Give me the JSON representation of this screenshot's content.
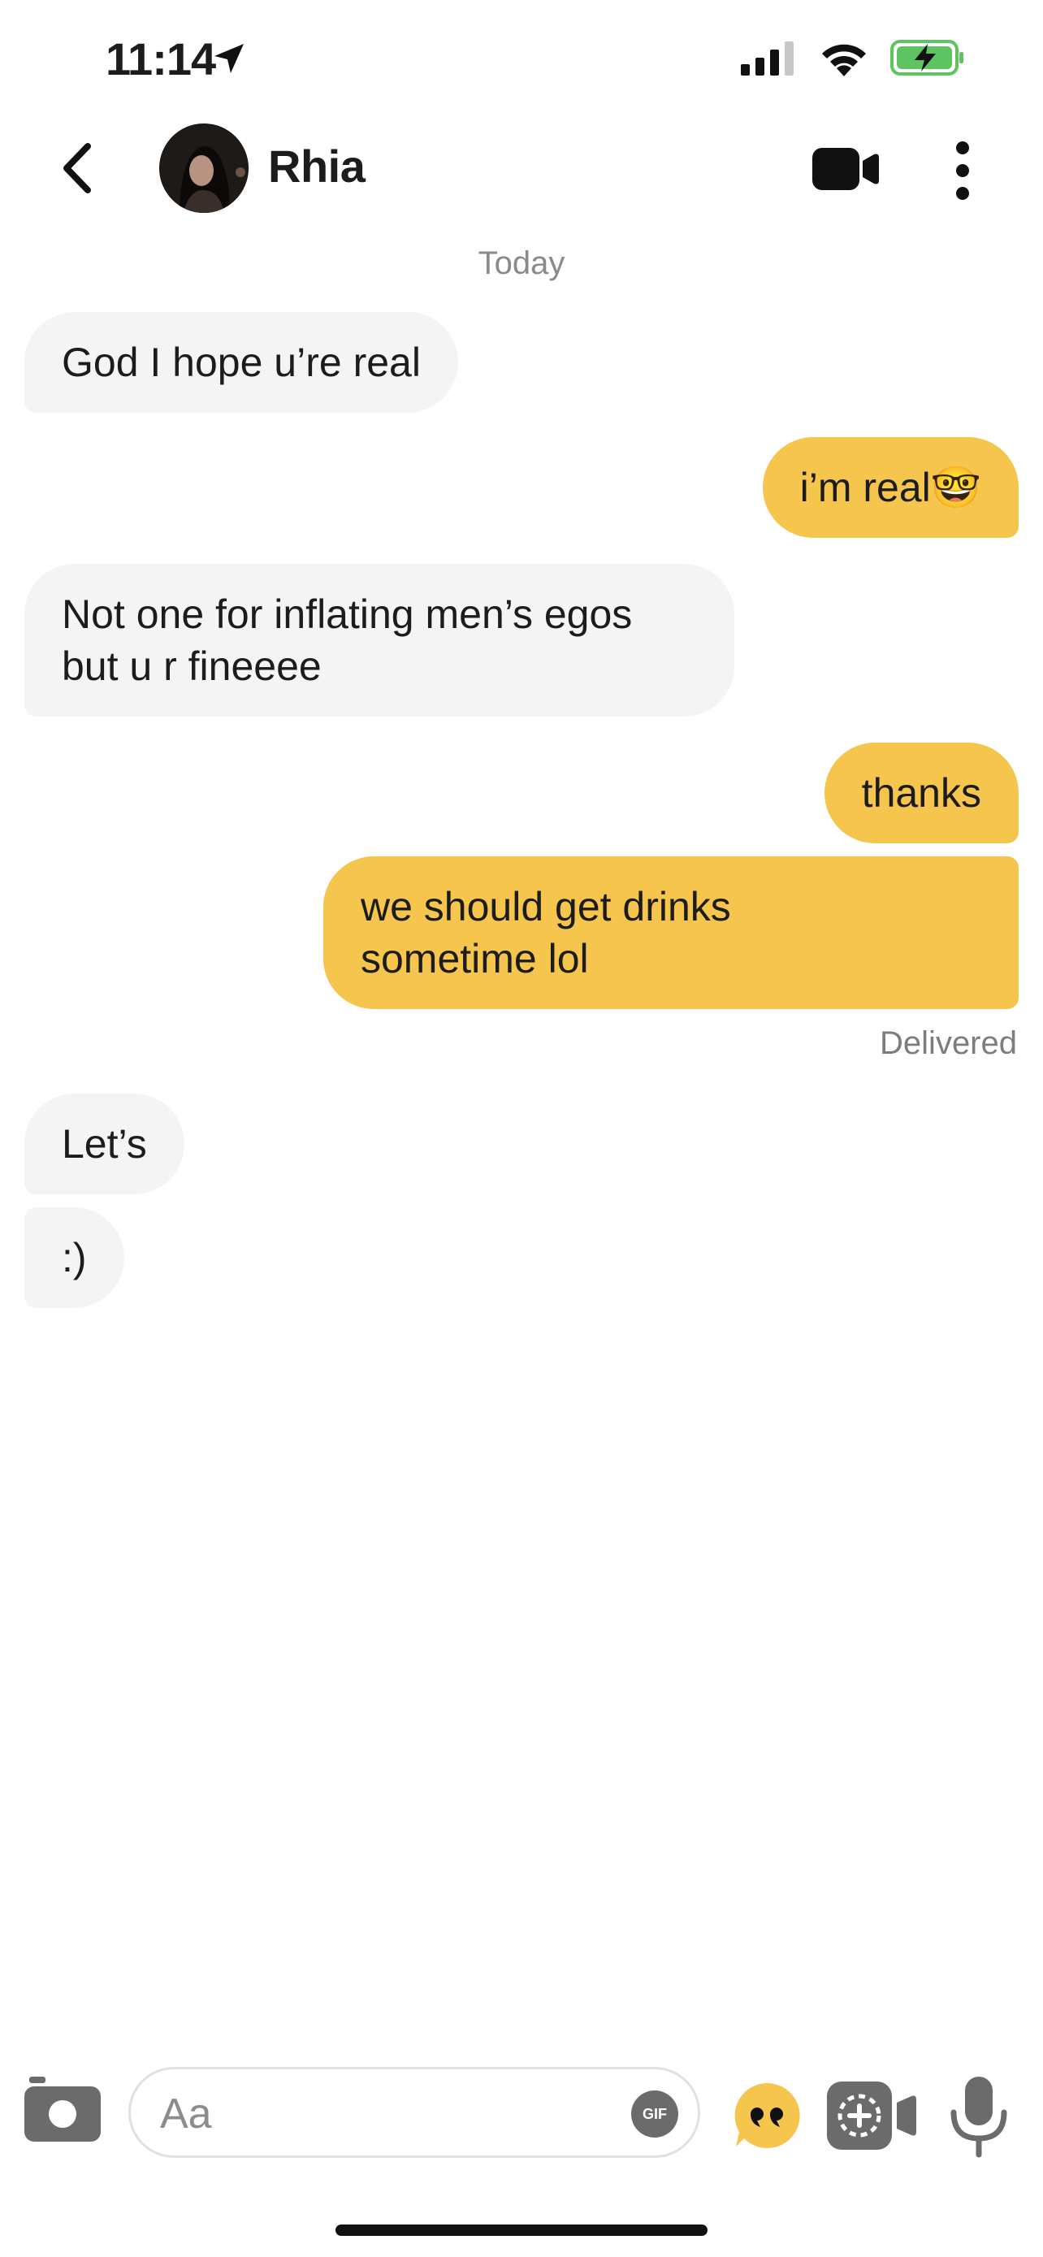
{
  "status_bar": {
    "time": "11:14",
    "battery_color": "#5ec461"
  },
  "header": {
    "contact_name": "Rhia"
  },
  "chat": {
    "date_separator": "Today",
    "messages": [
      {
        "side": "in",
        "lines": [
          "God I hope u’re real"
        ]
      },
      {
        "side": "out",
        "lines": [
          "i’m real🤓"
        ]
      },
      {
        "side": "in",
        "lines": [
          "Not one for inflating men’s egos",
          "but u r fineeee"
        ]
      },
      {
        "side": "out",
        "lines": [
          "thanks"
        ]
      },
      {
        "side": "out",
        "lines": [
          "we should get drinks",
          "sometime lol"
        ]
      },
      {
        "side": "in",
        "lines": [
          "Let’s"
        ]
      },
      {
        "side": "in",
        "lines": [
          ":)"
        ]
      }
    ],
    "delivered_status": "Delivered"
  },
  "composer": {
    "placeholder": "Aa",
    "gif_label": "GIF"
  },
  "colors": {
    "outgoing_bubble": "#f6c54e",
    "incoming_bubble": "#f4f4f4",
    "accent": "#f6c54e"
  }
}
